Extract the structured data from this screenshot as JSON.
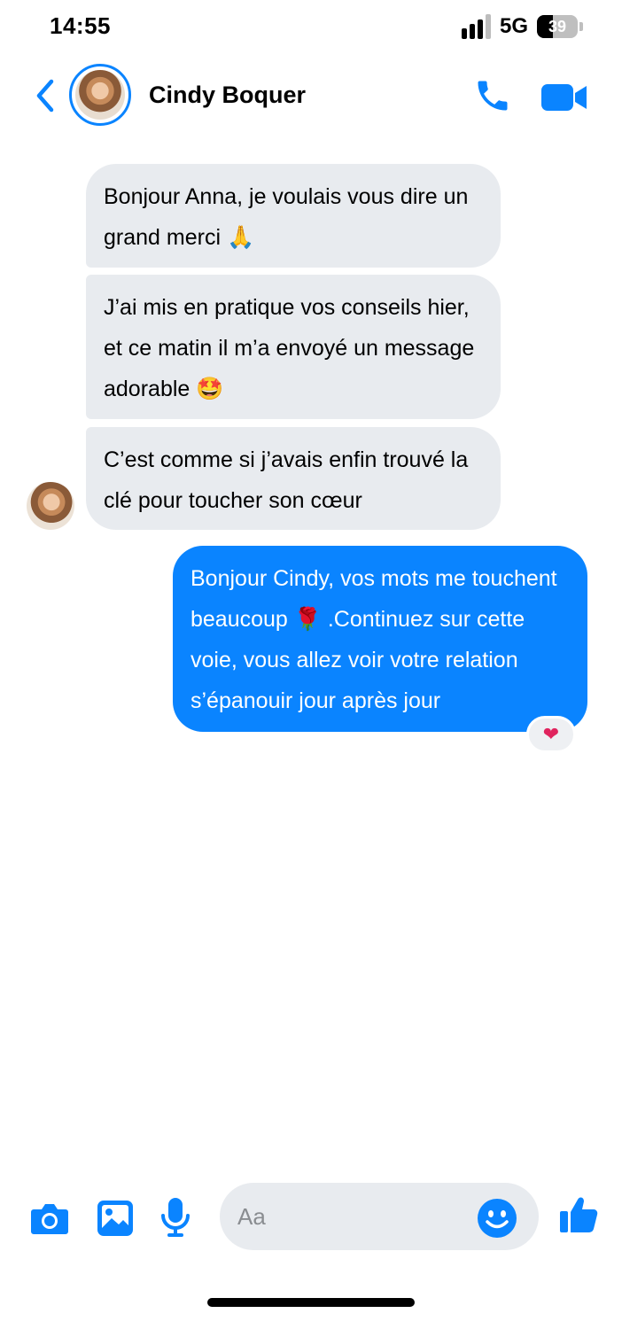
{
  "status_bar": {
    "time": "14:55",
    "network": "5G",
    "battery": "39",
    "battery_level": 0.39
  },
  "header": {
    "contact_name": "Cindy Boquer",
    "icons": [
      "back-chevron-icon",
      "phone-icon",
      "video-camera-icon"
    ]
  },
  "messages": [
    {
      "from": "incoming",
      "text": "Bonjour Anna, je voulais vous dire un grand merci 🙏"
    },
    {
      "from": "incoming",
      "text": "J’ai mis en pratique vos conseils hier, et ce matin il m’a envoyé un message adorable 🤩"
    },
    {
      "from": "incoming",
      "text": "C’est comme si j’avais enfin trouvé la clé pour toucher son cœur"
    },
    {
      "from": "outgoing",
      "text": "Bonjour Cindy, vos mots me touchent beaucoup 🌹 .Continuez sur cette voie, vous allez voir votre relation s’épanouir jour après jour",
      "reaction": "❤"
    }
  ],
  "composer": {
    "placeholder": "Aa",
    "icons": [
      "camera-icon",
      "photo-icon",
      "microphone-icon",
      "emoji-icon",
      "thumbs-up-icon"
    ]
  },
  "colors": {
    "accent": "#0a84ff",
    "incoming_bubble": "#e8ebef",
    "outgoing_bubble": "#0a84ff"
  }
}
